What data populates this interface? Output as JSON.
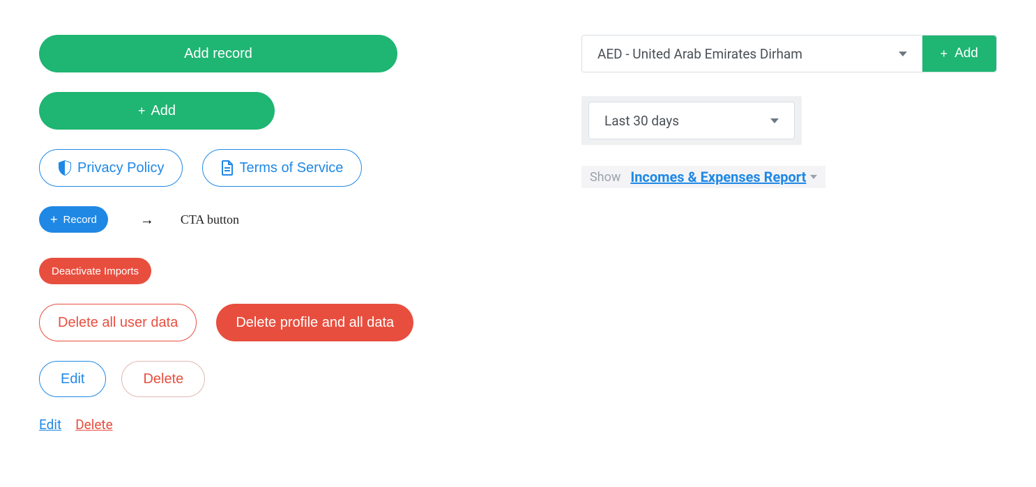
{
  "left": {
    "add_record": "Add record",
    "add": "Add",
    "privacy": "Privacy Policy",
    "terms": "Terms of Service",
    "record": "Record",
    "cta_note": "CTA button",
    "deactivate": "Deactivate Imports",
    "delete_user_data": "Delete all user data",
    "delete_profile": "Delete profile and all data",
    "edit": "Edit",
    "delete": "Delete",
    "edit_link": "Edit",
    "delete_link": "Delete"
  },
  "right": {
    "currency_selected": "AED - United Arab Emirates Dirham",
    "add": "Add",
    "period_selected": "Last 30 days",
    "show_label": "Show",
    "report_link": "Incomes & Expenses Report"
  }
}
